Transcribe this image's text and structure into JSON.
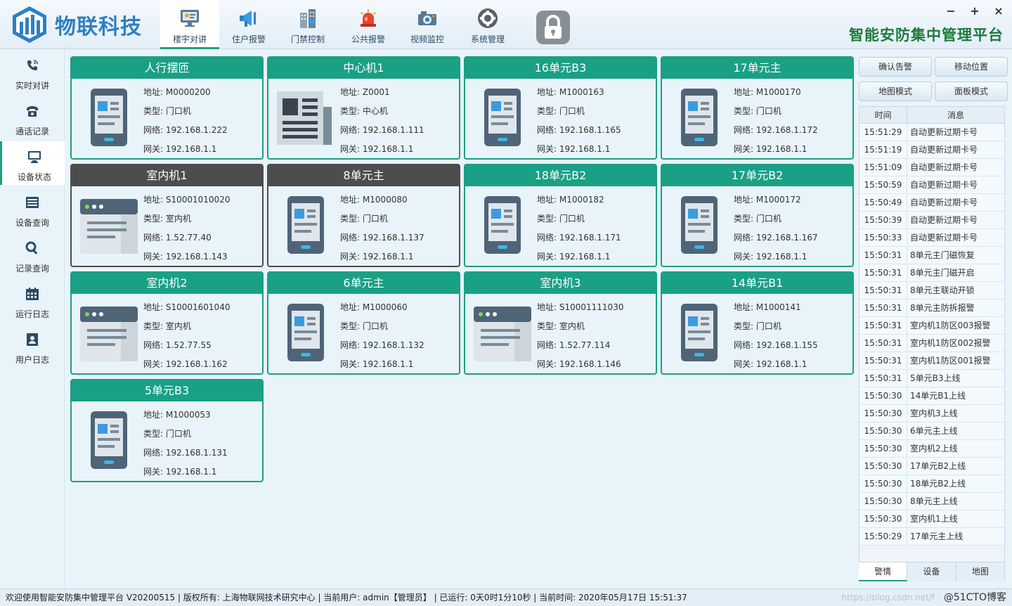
{
  "brand": {
    "name": "物联科技",
    "platform_title": "智能安防集中管理平台"
  },
  "colors": {
    "accent": "#1aa085",
    "offline": "#4d4d4d",
    "brand": "#2f7fc0",
    "title": "#1d7a3c"
  },
  "window_controls": {
    "minimize": "−",
    "maximize": "+",
    "close": "×"
  },
  "nav": [
    {
      "label": "楼宇对讲",
      "icon": "monitor-icon",
      "active": true
    },
    {
      "label": "住户报警",
      "icon": "speaker-icon"
    },
    {
      "label": "门禁控制",
      "icon": "building-icon"
    },
    {
      "label": "公共报警",
      "icon": "siren-icon"
    },
    {
      "label": "视频监控",
      "icon": "camera-icon"
    },
    {
      "label": "系统管理",
      "icon": "gear-icon"
    }
  ],
  "sidebar": [
    {
      "label": "实时对讲",
      "icon": "phone-call-icon"
    },
    {
      "label": "通话记录",
      "icon": "telephone-icon"
    },
    {
      "label": "设备状态",
      "icon": "desktop-icon",
      "active": true
    },
    {
      "label": "设备查询",
      "icon": "list-icon"
    },
    {
      "label": "记录查询",
      "icon": "search-icon"
    },
    {
      "label": "运行日志",
      "icon": "calendar-icon"
    },
    {
      "label": "用户日志",
      "icon": "user-card-icon"
    }
  ],
  "devices": [
    {
      "name": "人行摆匝",
      "icon": "phone-icon",
      "status": "online",
      "addr": "地址: M0000200",
      "type": "类型: 门口机",
      "net": "网络: 192.168.1.222",
      "gw": "网关: 192.168.1.1"
    },
    {
      "name": "中心机1",
      "icon": "newspaper-icon",
      "status": "online",
      "addr": "地址: Z0001",
      "type": "类型: 中心机",
      "net": "网络: 192.168.1.111",
      "gw": "网关: 192.168.1.1"
    },
    {
      "name": "16单元B3",
      "icon": "phone-icon",
      "status": "online",
      "addr": "地址: M1000163",
      "type": "类型: 门口机",
      "net": "网络: 192.168.1.165",
      "gw": "网关: 192.168.1.1"
    },
    {
      "name": "17单元主",
      "icon": "phone-icon",
      "status": "online",
      "addr": "地址: M1000170",
      "type": "类型: 门口机",
      "net": "网络: 192.168.1.172",
      "gw": "网关: 192.168.1.1"
    },
    {
      "name": "室内机1",
      "icon": "browser-icon",
      "status": "offline",
      "addr": "地址: S10001010020",
      "type": "类型: 室内机",
      "net": "网络: 1.52.77.40",
      "gw": "网关: 192.168.1.143"
    },
    {
      "name": "8单元主",
      "icon": "phone-icon",
      "status": "offline",
      "addr": "地址: M1000080",
      "type": "类型: 门口机",
      "net": "网络: 192.168.1.137",
      "gw": "网关: 192.168.1.1"
    },
    {
      "name": "18单元B2",
      "icon": "phone-icon",
      "status": "online",
      "addr": "地址: M1000182",
      "type": "类型: 门口机",
      "net": "网络: 192.168.1.171",
      "gw": "网关: 192.168.1.1"
    },
    {
      "name": "17单元B2",
      "icon": "phone-icon",
      "status": "online",
      "addr": "地址: M1000172",
      "type": "类型: 门口机",
      "net": "网络: 192.168.1.167",
      "gw": "网关: 192.168.1.1"
    },
    {
      "name": "室内机2",
      "icon": "browser-icon",
      "status": "online",
      "addr": "地址: S10001601040",
      "type": "类型: 室内机",
      "net": "网络: 1.52.77.55",
      "gw": "网关: 192.168.1.162"
    },
    {
      "name": "6单元主",
      "icon": "phone-icon",
      "status": "online",
      "addr": "地址: M1000060",
      "type": "类型: 门口机",
      "net": "网络: 192.168.1.132",
      "gw": "网关: 192.168.1.1"
    },
    {
      "name": "室内机3",
      "icon": "browser-icon",
      "status": "online",
      "addr": "地址: S10001111030",
      "type": "类型: 室内机",
      "net": "网络: 1.52.77.114",
      "gw": "网关: 192.168.1.146"
    },
    {
      "name": "14单元B1",
      "icon": "phone-icon",
      "status": "online",
      "addr": "地址: M1000141",
      "type": "类型: 门口机",
      "net": "网络: 192.168.1.155",
      "gw": "网关: 192.168.1.1"
    },
    {
      "name": "5单元B3",
      "icon": "phone-icon",
      "status": "online",
      "addr": "地址: M1000053",
      "type": "类型: 门口机",
      "net": "网络: 192.168.1.131",
      "gw": "网关: 192.168.1.1"
    }
  ],
  "right_buttons": {
    "confirm_alarm": "确认告警",
    "move_position": "移动位置",
    "map_mode": "地图模式",
    "panel_mode": "面板模式"
  },
  "alarm_table": {
    "headers": {
      "time": "时间",
      "message": "消息"
    },
    "rows": [
      {
        "time": "15:51:29",
        "msg": "自动更新过期卡号"
      },
      {
        "time": "15:51:19",
        "msg": "自动更新过期卡号"
      },
      {
        "time": "15:51:09",
        "msg": "自动更新过期卡号"
      },
      {
        "time": "15:50:59",
        "msg": "自动更新过期卡号"
      },
      {
        "time": "15:50:49",
        "msg": "自动更新过期卡号"
      },
      {
        "time": "15:50:39",
        "msg": "自动更新过期卡号"
      },
      {
        "time": "15:50:33",
        "msg": "自动更新过期卡号"
      },
      {
        "time": "15:50:31",
        "msg": "8单元主门磁恢复"
      },
      {
        "time": "15:50:31",
        "msg": "8单元主门磁开启"
      },
      {
        "time": "15:50:31",
        "msg": "8单元主联动开锁"
      },
      {
        "time": "15:50:31",
        "msg": "8单元主防拆报警"
      },
      {
        "time": "15:50:31",
        "msg": "室内机1防区003报警"
      },
      {
        "time": "15:50:31",
        "msg": "室内机1防区002报警"
      },
      {
        "time": "15:50:31",
        "msg": "室内机1防区001报警"
      },
      {
        "time": "15:50:31",
        "msg": "5单元B3上线"
      },
      {
        "time": "15:50:30",
        "msg": "14单元B1上线"
      },
      {
        "time": "15:50:30",
        "msg": "室内机3上线"
      },
      {
        "time": "15:50:30",
        "msg": "6单元主上线"
      },
      {
        "time": "15:50:30",
        "msg": "室内机2上线"
      },
      {
        "time": "15:50:30",
        "msg": "17单元B2上线"
      },
      {
        "time": "15:50:30",
        "msg": "18单元B2上线"
      },
      {
        "time": "15:50:30",
        "msg": "8单元主上线"
      },
      {
        "time": "15:50:30",
        "msg": "室内机1上线"
      },
      {
        "time": "15:50:29",
        "msg": "17单元主上线"
      }
    ]
  },
  "right_tabs": [
    {
      "label": "警情",
      "active": true
    },
    {
      "label": "设备"
    },
    {
      "label": "地图"
    }
  ],
  "status_bar": {
    "text": "欢迎使用智能安防集中管理平台 V20200515 | 版权所有: 上海物联网技术研究中心 | 当前用户: admin【管理员】 | 已运行: 0天0时1分10秒 | 当前时间: 2020年05月17日 15:51:37",
    "watermark_url": "https://blog.csdn.net/f",
    "watermark": "@51CTO博客"
  }
}
